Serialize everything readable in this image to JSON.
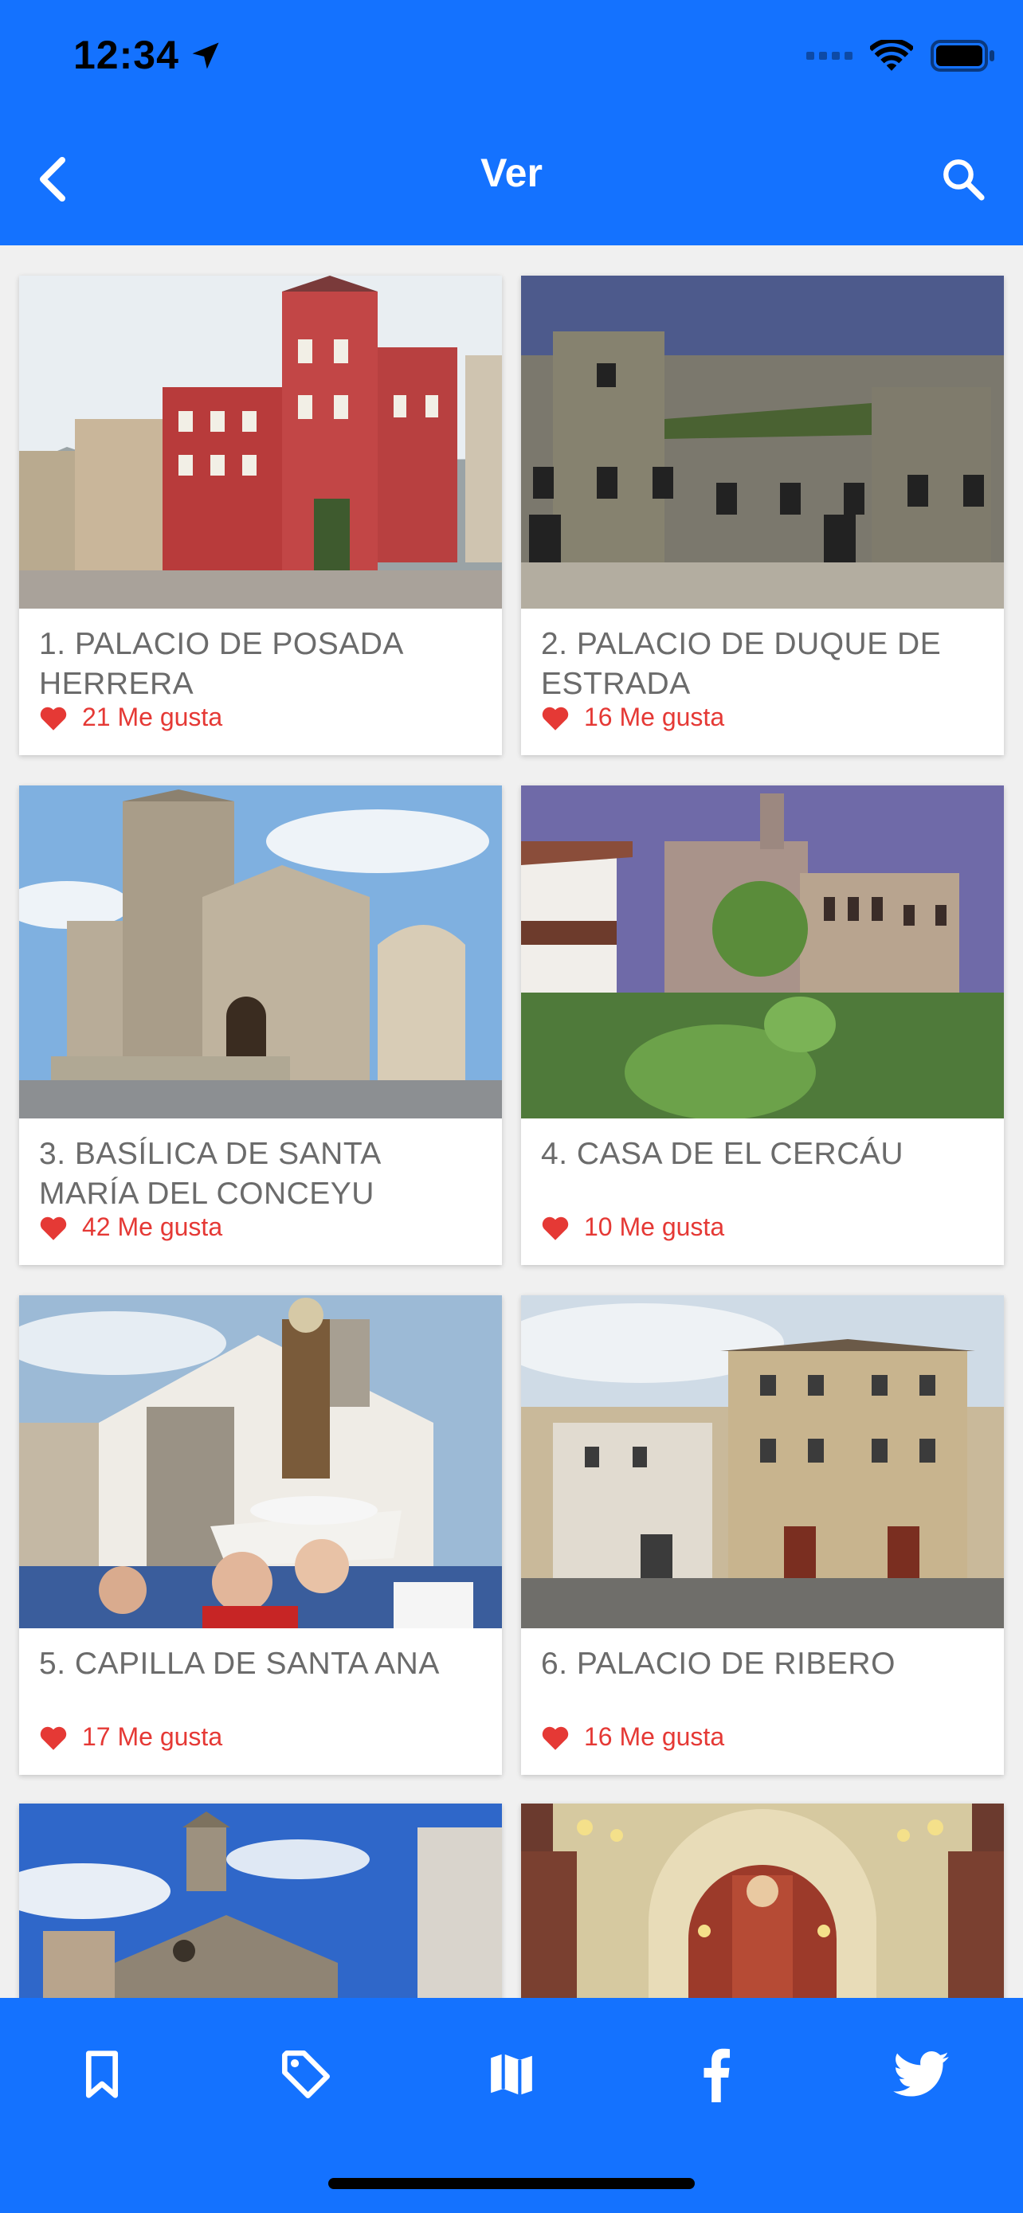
{
  "status_bar": {
    "time": "12:34"
  },
  "nav": {
    "title": "Ver"
  },
  "cards": [
    {
      "title": "1. PALACIO DE POSADA HERRERA",
      "likes": "21 Me gusta"
    },
    {
      "title": "2. PALACIO DE DUQUE DE ESTRADA",
      "likes": "16 Me gusta"
    },
    {
      "title": "3. BASÍLICA DE SANTA MARÍA DEL CONCEYU",
      "likes": "42 Me gusta"
    },
    {
      "title": "4. CASA DE EL CERCÁU",
      "likes": "10 Me gusta"
    },
    {
      "title": "5. CAPILLA DE SANTA ANA",
      "likes": "17 Me gusta"
    },
    {
      "title": "6. PALACIO DE RIBERO",
      "likes": "16 Me gusta"
    },
    {
      "title": "",
      "likes": ""
    },
    {
      "title": "",
      "likes": ""
    }
  ],
  "tabbar": {
    "items": [
      {
        "icon": "bookmark-icon"
      },
      {
        "icon": "tag-icon"
      },
      {
        "icon": "map-icon"
      },
      {
        "icon": "facebook-icon"
      },
      {
        "icon": "twitter-icon"
      }
    ]
  },
  "colors": {
    "primary": "#1472ff",
    "like": "#e53935",
    "title_text": "#6b6b6b",
    "background": "#f0f0f0"
  }
}
